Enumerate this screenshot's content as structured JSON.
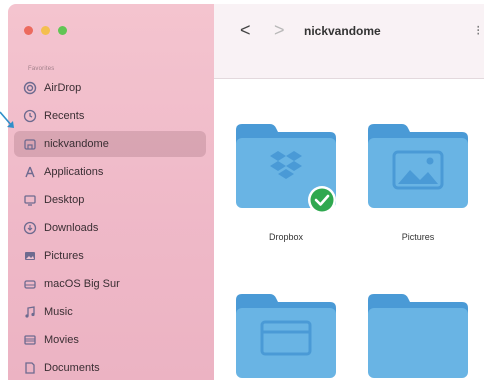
{
  "sidebar": {
    "section": "Favorites",
    "items": [
      {
        "label": "AirDrop",
        "icon": "airdrop-icon"
      },
      {
        "label": "Recents",
        "icon": "clock-icon"
      },
      {
        "label": "nickvandome",
        "icon": "home-icon"
      },
      {
        "label": "Applications",
        "icon": "applications-icon"
      },
      {
        "label": "Desktop",
        "icon": "desktop-icon"
      },
      {
        "label": "Downloads",
        "icon": "downloads-icon"
      },
      {
        "label": "Pictures",
        "icon": "pictures-icon"
      },
      {
        "label": "macOS Big Sur",
        "icon": "drive-icon"
      },
      {
        "label": "Music",
        "icon": "music-icon"
      },
      {
        "label": "Movies",
        "icon": "movies-icon"
      },
      {
        "label": "Documents",
        "icon": "documents-icon"
      }
    ],
    "selected_index": 2
  },
  "toolbar": {
    "back_glyph": "<",
    "forward_glyph": ">",
    "title": "nickvandome",
    "overflow_glyph": "⁝"
  },
  "folders": [
    {
      "label": "Dropbox",
      "icon": "dropbox-folder-icon",
      "badge": "checkmark-badge-icon"
    },
    {
      "label": "Pictures",
      "icon": "pictures-folder-icon"
    },
    {
      "label": "",
      "icon": "folder-icon"
    },
    {
      "label": "",
      "icon": "folder-icon"
    }
  ],
  "colors": {
    "sidebar_pink": "#efb9c8",
    "folder_blue": "#69b4e4",
    "folder_tab": "#4a9ad6",
    "badge_green": "#2fa84f",
    "accent_arrow": "#2f8fc9"
  }
}
